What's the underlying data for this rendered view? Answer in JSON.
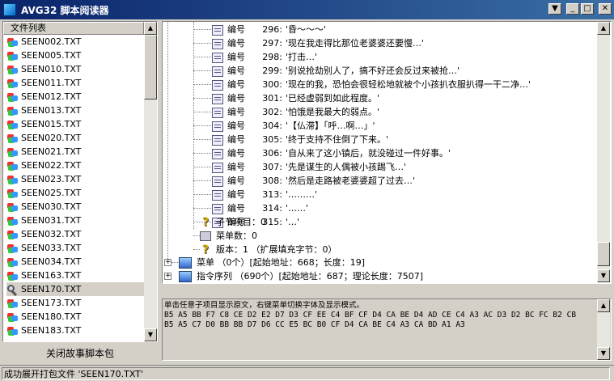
{
  "window": {
    "title": "AVG32 脚本阅读器"
  },
  "file_list": {
    "header": "文件列表",
    "items": [
      "SEEN002.TXT",
      "SEEN005.TXT",
      "SEEN010.TXT",
      "SEEN011.TXT",
      "SEEN012.TXT",
      "SEEN013.TXT",
      "SEEN015.TXT",
      "SEEN020.TXT",
      "SEEN021.TXT",
      "SEEN022.TXT",
      "SEEN023.TXT",
      "SEEN025.TXT",
      "SEEN030.TXT",
      "SEEN031.TXT",
      "SEEN032.TXT",
      "SEEN033.TXT",
      "SEEN034.TXT",
      "SEEN163.TXT",
      "SEEN170.TXT",
      "SEEN173.TXT",
      "SEEN180.TXT",
      "SEEN183.TXT"
    ],
    "selected": "SEEN170.TXT"
  },
  "close_button": "关闭故事脚本包",
  "tree": {
    "entries": [
      {
        "label": "编号",
        "num": "296:",
        "text": "'昏～～～'"
      },
      {
        "label": "编号",
        "num": "297:",
        "text": "'现在我走得比那位老婆婆还要慢…'"
      },
      {
        "label": "编号",
        "num": "298:",
        "text": "'打击…'"
      },
      {
        "label": "编号",
        "num": "299:",
        "text": "'别说抢劫别人了，搞不好还会反过来被抢…'"
      },
      {
        "label": "编号",
        "num": "300:",
        "text": "'现在的我，恐怕会很轻松地就被个小孩扒衣服扒得一干二净…'"
      },
      {
        "label": "编号",
        "num": "301:",
        "text": "'已经虚弱到如此程度。'"
      },
      {
        "label": "编号",
        "num": "302:",
        "text": "'怕饿是我最大的弱点。'"
      },
      {
        "label": "编号",
        "num": "304:",
        "text": "'【仏滞】「呼…啊…」'"
      },
      {
        "label": "编号",
        "num": "305:",
        "text": "'终于支持不住倒了下来。'"
      },
      {
        "label": "编号",
        "num": "306:",
        "text": "'自从来了这小镇后，就没碰过一件好事。'"
      },
      {
        "label": "编号",
        "num": "307:",
        "text": "'先是谋生的人偶被小孩踢飞…'"
      },
      {
        "label": "编号",
        "num": "308:",
        "text": "'然后是走路被老婆婆超了过去…'"
      },
      {
        "label": "编号",
        "num": "313:",
        "text": "'………'"
      },
      {
        "label": "编号",
        "num": "314:",
        "text": "'……'"
      },
      {
        "label": "编号",
        "num": "315:",
        "text": "'…'"
      }
    ],
    "subnode_count": "子节项目：0",
    "menu_count": "菜单数：0",
    "version": "版本：1 （扩展填充字节：0）",
    "menu_node": "菜单 （0个）[起始地址：668；长度：19]",
    "cmd_node": "指令序列 （690个）[起始地址：687；理论长度：7507]"
  },
  "hex_panel": {
    "lines": [
      "单击任意子项目显示原文，右键菜单切换字体及显示模式。",
      "B5 A5 BB F7 C8 CE D2 E2 D7 D3 CF EE C4 BF CF D4 CA BE D4 AD CE C4 A3 AC D3 D2 BC FC B2 CB",
      "B5 A5 C7 D0 BB BB D7 D6 CC E5 BC B0 CF D4 CA BE C4 A3 CA BD A1 A3"
    ]
  },
  "status": {
    "text": "成功展开打包文件 'SEEN170.TXT'"
  }
}
